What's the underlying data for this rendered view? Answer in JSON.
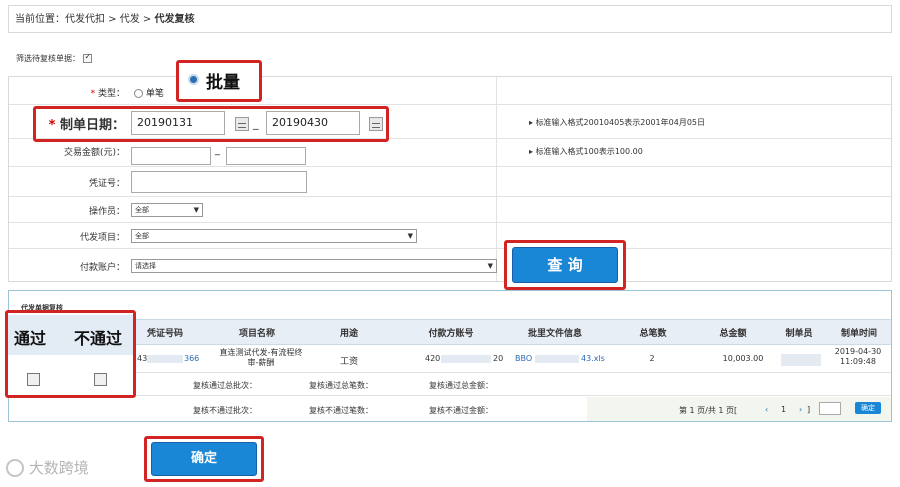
{
  "breadcrumb": {
    "prefix": "当前位置：代发代扣 > 代发 > ",
    "current": "代发复核"
  },
  "filter": {
    "label": "筛选待复核单据："
  },
  "form": {
    "type": {
      "label": "类型：",
      "option_single": "单笔",
      "option_batch": "批量"
    },
    "date": {
      "label": "制单日期：",
      "from": "20190131",
      "separator": "_",
      "to": "20190430",
      "hint": "标准输入格式20010405表示2001年04月05日"
    },
    "amount": {
      "label": "交易金额(元)：",
      "separator": "_",
      "hint": "标准输入格式100表示100.00"
    },
    "voucher": {
      "label": "凭证号："
    },
    "operator": {
      "label": "操作员：",
      "value": "全部"
    },
    "project": {
      "label": "代发项目：",
      "value": "全部"
    },
    "account": {
      "label": "付款账户：",
      "value": "请选择"
    },
    "query_button": "查 询"
  },
  "table": {
    "caption": "代发单据复核",
    "headers": {
      "pass": "通过",
      "fail": "不通过",
      "voucher": "凭证号码",
      "project": "项目名称",
      "purpose": "用途",
      "payer": "付款方账号",
      "batch_file": "批里文件信息",
      "total_count": "总笔数",
      "total_amount": "总金额",
      "creator": "制单员",
      "created_at": "制单时间"
    },
    "rows": [
      {
        "voucher_a": "43",
        "voucher_b": "366",
        "project": "直连测试代发-有流程终审-薪酬",
        "purpose": "工资",
        "payer_a": "420",
        "payer_b": "20",
        "batch_a": "BBO",
        "batch_b": "43.xls",
        "total_count": "2",
        "total_amount": "10,003.00",
        "date": "2019-04-30",
        "time": "11:09:48"
      }
    ],
    "summary_pass": {
      "batches": "复核通过总批次：",
      "count": "复核通过总笔数：",
      "amount": "复核通过总金额："
    },
    "summary_fail": {
      "batches": "复核不通过批次：",
      "count": "复核不通过笔数：",
      "amount": "复核不通过金额："
    },
    "pager": {
      "text": "第 1 页/共 1 页[",
      "prev": "‹",
      "page": "1",
      "next": "›",
      "close": "]",
      "go": "确定"
    }
  },
  "confirm_button": "确定",
  "watermark": "大数跨境",
  "colors": {
    "accent": "#1a86d6",
    "highlight": "#d32424",
    "required": "#d60000"
  }
}
